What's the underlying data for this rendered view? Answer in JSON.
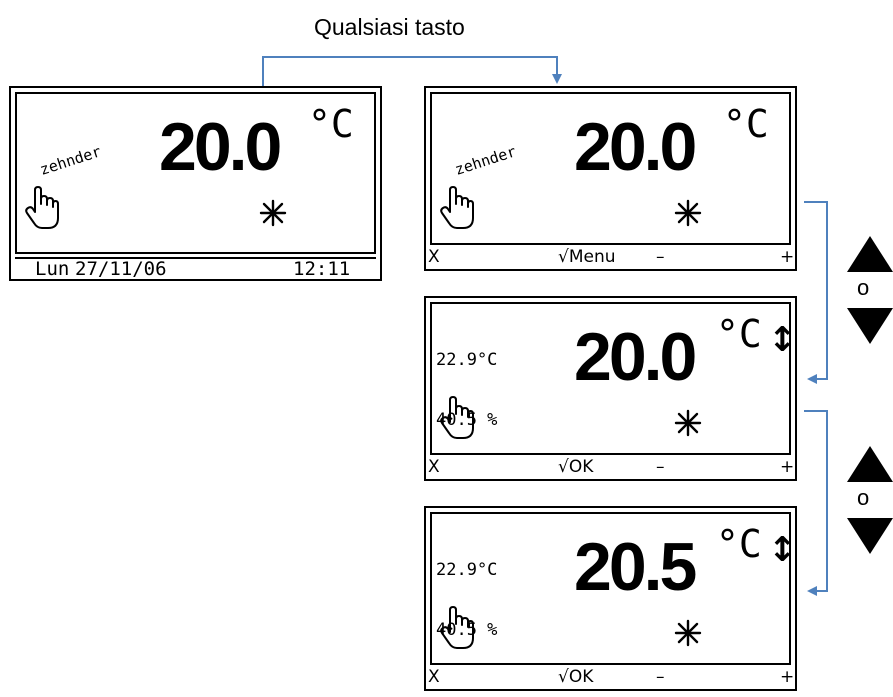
{
  "caption": "Qualsiasi tasto",
  "or_label": "o",
  "colors": {
    "connector": "#4f81bd",
    "lcd": "#000000",
    "background": "#ffffff"
  },
  "screens": [
    {
      "logo": "zehnder",
      "setpoint": "20.0",
      "unit": "°C",
      "status_bar": {
        "day": "Lun",
        "date": "27/11/06",
        "time": "12:11"
      },
      "icons": [
        "hand-icon",
        "snowflake-icon"
      ]
    },
    {
      "logo": "zehnder",
      "setpoint": "20.0",
      "unit": "°C",
      "softkeys": {
        "cancel": "X",
        "confirm": "√Menu",
        "minus": "–",
        "plus": "+"
      },
      "icons": [
        "hand-icon",
        "snowflake-icon"
      ]
    },
    {
      "room_temp": "22.9°C",
      "humidity": "40.5 %",
      "setpoint": "20.0",
      "unit": "°C",
      "adjust_icon": "↕",
      "softkeys": {
        "cancel": "X",
        "confirm": "√OK",
        "minus": "–",
        "plus": "+"
      },
      "icons": [
        "hand-icon",
        "snowflake-icon",
        "up-down-arrow-icon"
      ]
    },
    {
      "room_temp": "22.9°C",
      "humidity": "40.5 %",
      "setpoint": "20.5",
      "unit": "°C",
      "adjust_icon": "↕",
      "softkeys": {
        "cancel": "X",
        "confirm": "√OK",
        "minus": "–",
        "plus": "+"
      },
      "icons": [
        "hand-icon",
        "snowflake-icon",
        "up-down-arrow-icon"
      ]
    }
  ],
  "side_keys": [
    {
      "icons": [
        "arrow-up-icon",
        "arrow-down-icon"
      ]
    },
    {
      "icons": [
        "arrow-up-icon",
        "arrow-down-icon"
      ]
    }
  ]
}
